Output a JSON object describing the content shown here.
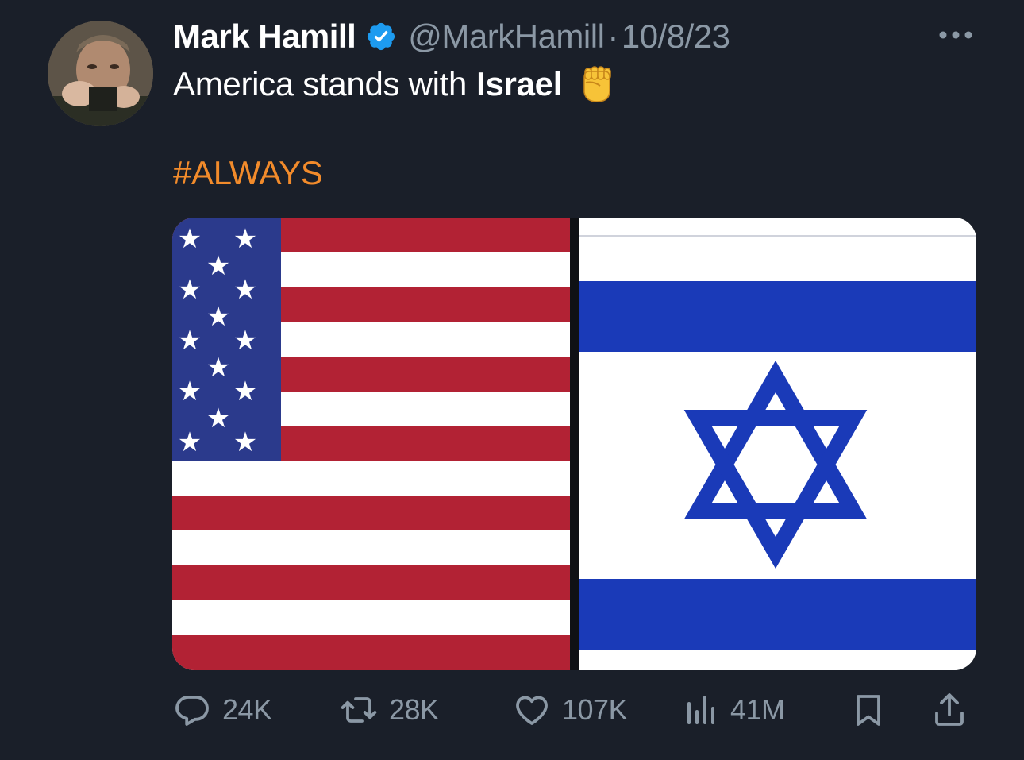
{
  "author": {
    "display_name": "Mark Hamill",
    "handle": "@MarkHamill",
    "separator": "·",
    "date": "10/8/23",
    "verified_icon": "verified-badge-icon"
  },
  "tweet": {
    "text_plain": "America stands with",
    "text_bold": "Israel",
    "emoji": "raised-fist-emoji",
    "hashtag": "#ALWAYS"
  },
  "media": {
    "left_image": "united-states-flag",
    "right_image": "israel-flag"
  },
  "actions": {
    "replies": "24K",
    "retweets": "28K",
    "likes": "107K",
    "views": "41M"
  },
  "colors": {
    "background": "#1a1f29",
    "text": "#ffffff",
    "secondary": "#8b98a5",
    "hashtag": "#f28b2b",
    "verified": "#1d9bf0",
    "us_red": "#b22234",
    "us_blue": "#2b3a8c",
    "il_blue": "#1a3ab8"
  }
}
